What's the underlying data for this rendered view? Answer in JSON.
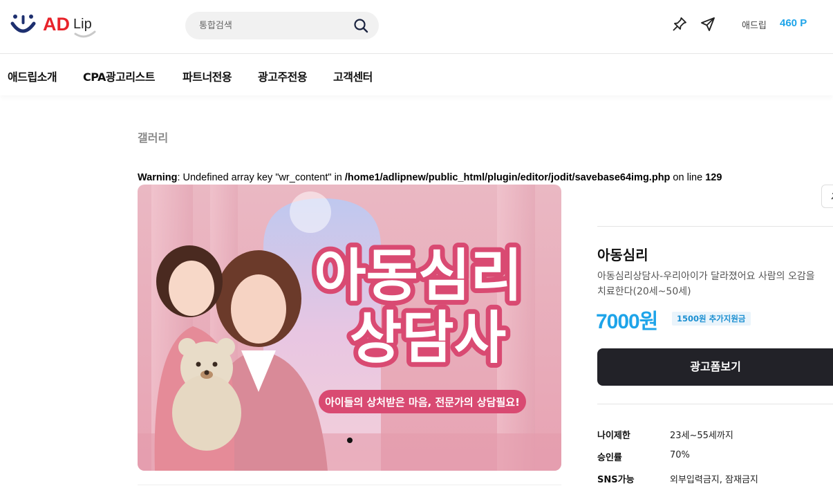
{
  "header": {
    "logo_text": "ADLip",
    "search_placeholder": "통합검색",
    "point_label": "애드립",
    "point_value": "460 P"
  },
  "nav": {
    "items": [
      "애드립소개",
      "CPA광고리스트",
      "파트너전용",
      "광고주전용",
      "고객센터"
    ]
  },
  "page": {
    "breadcrumb": "갤러리",
    "warning": {
      "prefix": "Warning",
      "message": ": Undefined array key \"wr_content\" in ",
      "path": "/home1/adlipnew/public_html/plugin/editor/jodit/savebase64img.php",
      "line_text": " on line ",
      "line_no": "129"
    }
  },
  "banner": {
    "headline_line1": "아동심리",
    "headline_line2": "상담사",
    "tagline": "아이들의 상처받은 마음, 전문가의 상담필요!",
    "slide_count": 1,
    "active_slide": 1
  },
  "product": {
    "title": "아동심리",
    "description": "아동심리상담사-우리아이가 달라졌어요 사람의 오감을 치료한다(20세~50세)",
    "price": "7000원",
    "bonus_badge": "1500원 추가지원금",
    "cta_label": "광고폼보기",
    "info": [
      {
        "label": "나이제한",
        "value": "23세~55세까지"
      },
      {
        "label": "승인률",
        "value": "70%"
      },
      {
        "label": "SNS가능",
        "value": "외부입력금지, 잠재금지"
      }
    ]
  },
  "colors": {
    "accent": "#1ea4e9",
    "logo_red": "#e8232a",
    "logo_navy": "#1d2f6f",
    "cta_bg": "#222228",
    "banner_pink": "#e8a6b6",
    "headline_fill": "#d94a72"
  },
  "icons": {
    "search": "search-icon",
    "pin": "pin-icon",
    "send": "send-icon"
  }
}
